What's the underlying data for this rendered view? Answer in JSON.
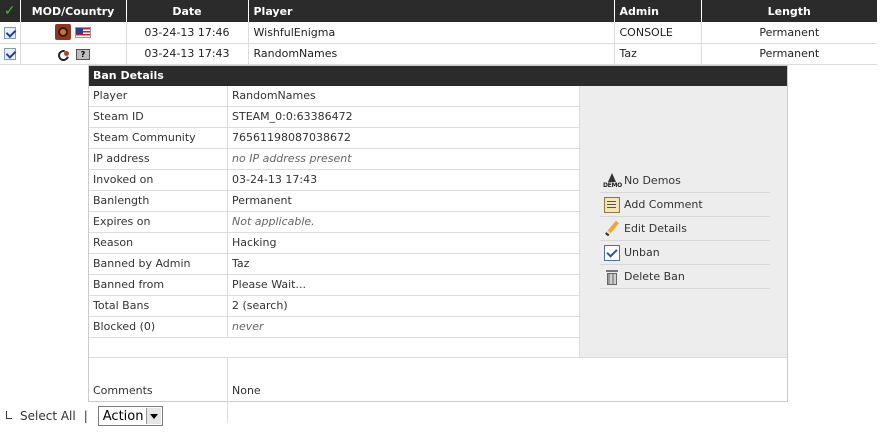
{
  "table": {
    "columns": [
      "MOD/Country",
      "Date",
      "Player",
      "Admin",
      "Length"
    ],
    "rows": [
      {
        "date": "03-24-13 17:46",
        "player": "WishfulEnigma",
        "admin": "CONSOLE",
        "length": "Permanent",
        "mod_icon": "tf2-icon",
        "country_icon": "us-flag-icon"
      },
      {
        "date": "03-24-13 17:43",
        "player": "RandomNames",
        "admin": "Taz",
        "length": "Permanent",
        "mod_icon": "mod-icon",
        "country_icon": "unknown-flag-icon",
        "unknown_flag_text": "?"
      }
    ]
  },
  "details": {
    "title": "Ban Details",
    "rows": [
      {
        "label": "Player",
        "value": "RandomNames"
      },
      {
        "label": "Steam ID",
        "value": "STEAM_0:0:63386472"
      },
      {
        "label": "Steam Community",
        "value": "76561198087038672"
      },
      {
        "label": "IP address",
        "value": "no IP address present"
      },
      {
        "label": "Invoked on",
        "value": "03-24-13 17:43"
      },
      {
        "label": "Banlength",
        "value": "Permanent"
      },
      {
        "label": "Expires on",
        "value": "Not applicable."
      },
      {
        "label": "Reason",
        "value": "Hacking"
      },
      {
        "label": "Banned by Admin",
        "value": "Taz"
      },
      {
        "label": "Banned from",
        "value": "Please Wait..."
      },
      {
        "label": "Total Bans",
        "value": "2 (search)"
      },
      {
        "label": "Blocked (0)",
        "value": "never"
      }
    ],
    "comments": {
      "label": "Comments",
      "value": "None"
    }
  },
  "actions": [
    {
      "label": "No Demos",
      "icon": "demo-icon"
    },
    {
      "label": "Add Comment",
      "icon": "comment-icon"
    },
    {
      "label": "Edit Details",
      "icon": "pencil-icon"
    },
    {
      "label": "Unban",
      "icon": "unban-icon"
    },
    {
      "label": "Delete Ban",
      "icon": "trash-icon"
    }
  ],
  "footer": {
    "select_all": "Select All",
    "separator": "|",
    "action_select": "Action"
  },
  "colors": {
    "header_bg": "#2b2b2b",
    "actions_panel_bg": "#ededed",
    "row_border": "#dcdcdc"
  }
}
